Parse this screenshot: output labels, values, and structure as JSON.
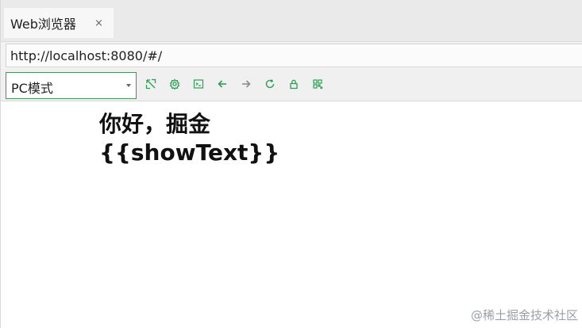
{
  "tab": {
    "title": "Web浏览器",
    "close": "×"
  },
  "address": {
    "url": "http://localhost:8080/#/"
  },
  "toolbar": {
    "mode_value": "PC模式",
    "buttons": [
      "expand-icon",
      "gear-icon",
      "terminal-icon",
      "arrow-left-icon",
      "arrow-right-icon",
      "refresh-icon",
      "lock-icon",
      "qr-code-icon"
    ],
    "accent_color": "#2aa155"
  },
  "page": {
    "line1": "你好，掘金",
    "line2": "{{showText}}"
  },
  "watermark": "@稀土掘金技术社区"
}
